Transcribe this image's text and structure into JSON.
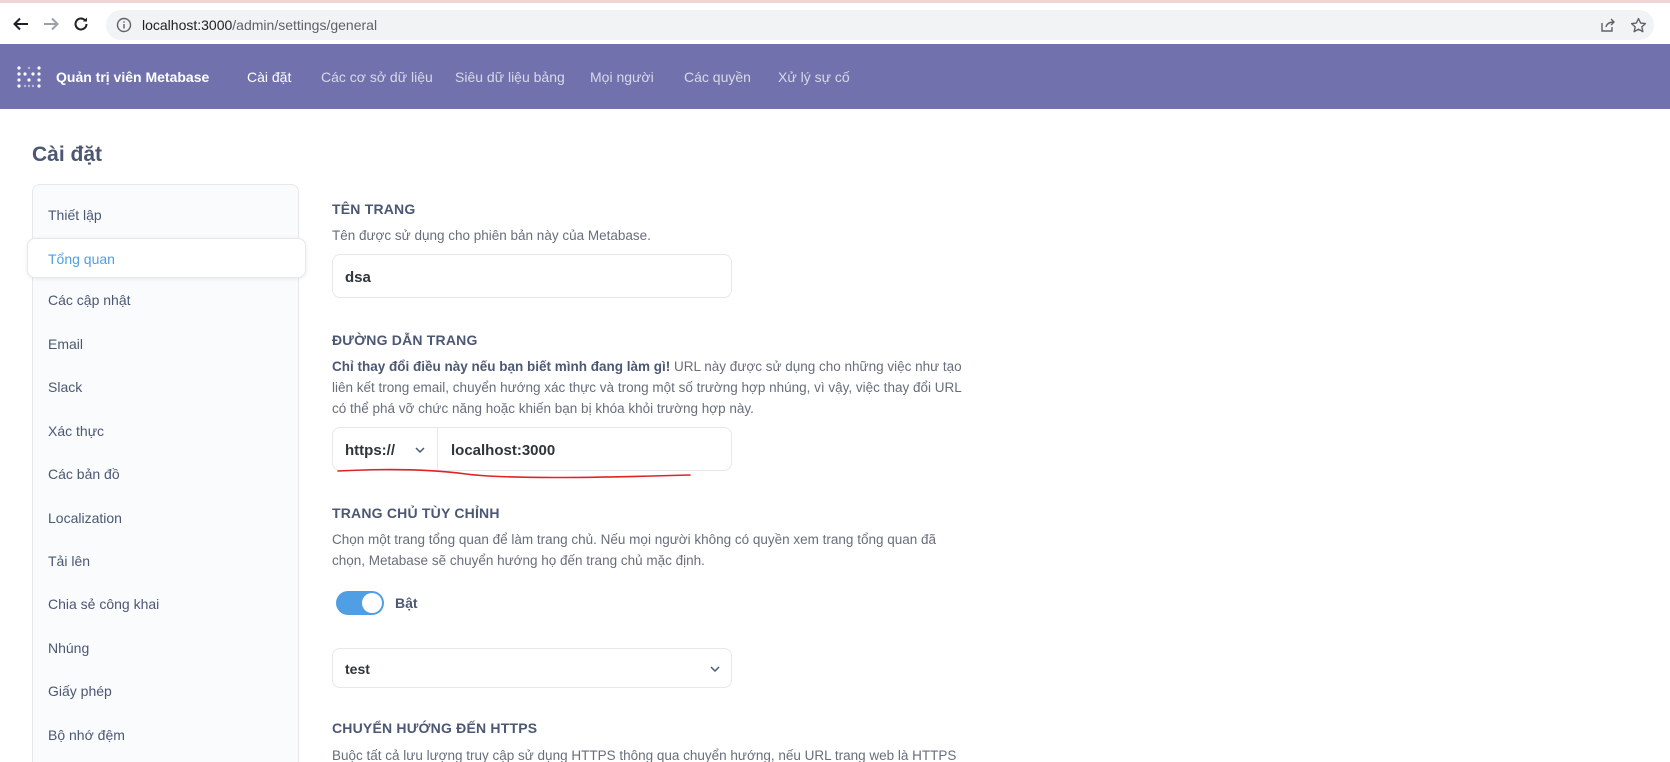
{
  "browser": {
    "url_host": "localhost:3000",
    "url_path": "/admin/settings/general"
  },
  "nav": {
    "brand": "Quản trị viên Metabase",
    "items": [
      "Cài đặt",
      "Các cơ sở dữ liệu",
      "Siêu dữ liệu bảng",
      "Mọi người",
      "Các quyền",
      "Xử lý sự cố"
    ]
  },
  "page": {
    "title": "Cài đặt"
  },
  "sidebar": {
    "items": [
      "Thiết lập",
      "Tổng quan",
      "Các cập nhật",
      "Email",
      "Slack",
      "Xác thực",
      "Các bản đồ",
      "Localization",
      "Tải lên",
      "Chia sẻ công khai",
      "Nhúng",
      "Giấy phép",
      "Bộ nhớ đệm"
    ]
  },
  "site_name": {
    "heading": "TÊN TRANG",
    "description": "Tên được sử dụng cho phiên bản này của Metabase.",
    "value": "dsa"
  },
  "site_url": {
    "heading": "ĐƯỜNG DẪN TRANG",
    "warning": "Chỉ thay đổi điều này nếu bạn biết mình đang làm gì!",
    "description": " URL này được sử dụng cho những việc như tạo liên kết trong email, chuyển hướng xác thực và trong một số trường hợp nhúng, vì vậy, việc thay đổi URL có thể phá vỡ chức năng hoặc khiến bạn bị khóa khỏi trường hợp này.",
    "protocol": "https://",
    "value": "localhost:3000"
  },
  "custom_homepage": {
    "heading": "TRANG CHỦ TÙY CHỈNH",
    "description": "Chọn một trang tổng quan để làm trang chủ. Nếu mọi người không có quyền xem trang tổng quan đã chọn, Metabase sẽ chuyển hướng họ đến trang chủ mặc định.",
    "toggle_label": "Bật",
    "toggle_on": true,
    "selected_dashboard": "test"
  },
  "https_redirect": {
    "heading": "CHUYỂN HƯỚNG ĐẾN HTTPS",
    "description": "Buộc tất cả lưu lượng truy cập sử dụng HTTPS thông qua chuyển hướng, nếu URL trang web là HTTPS"
  },
  "colors": {
    "nav_bg": "#7172ad",
    "accent": "#509ee3",
    "annotation": "#e02424"
  }
}
